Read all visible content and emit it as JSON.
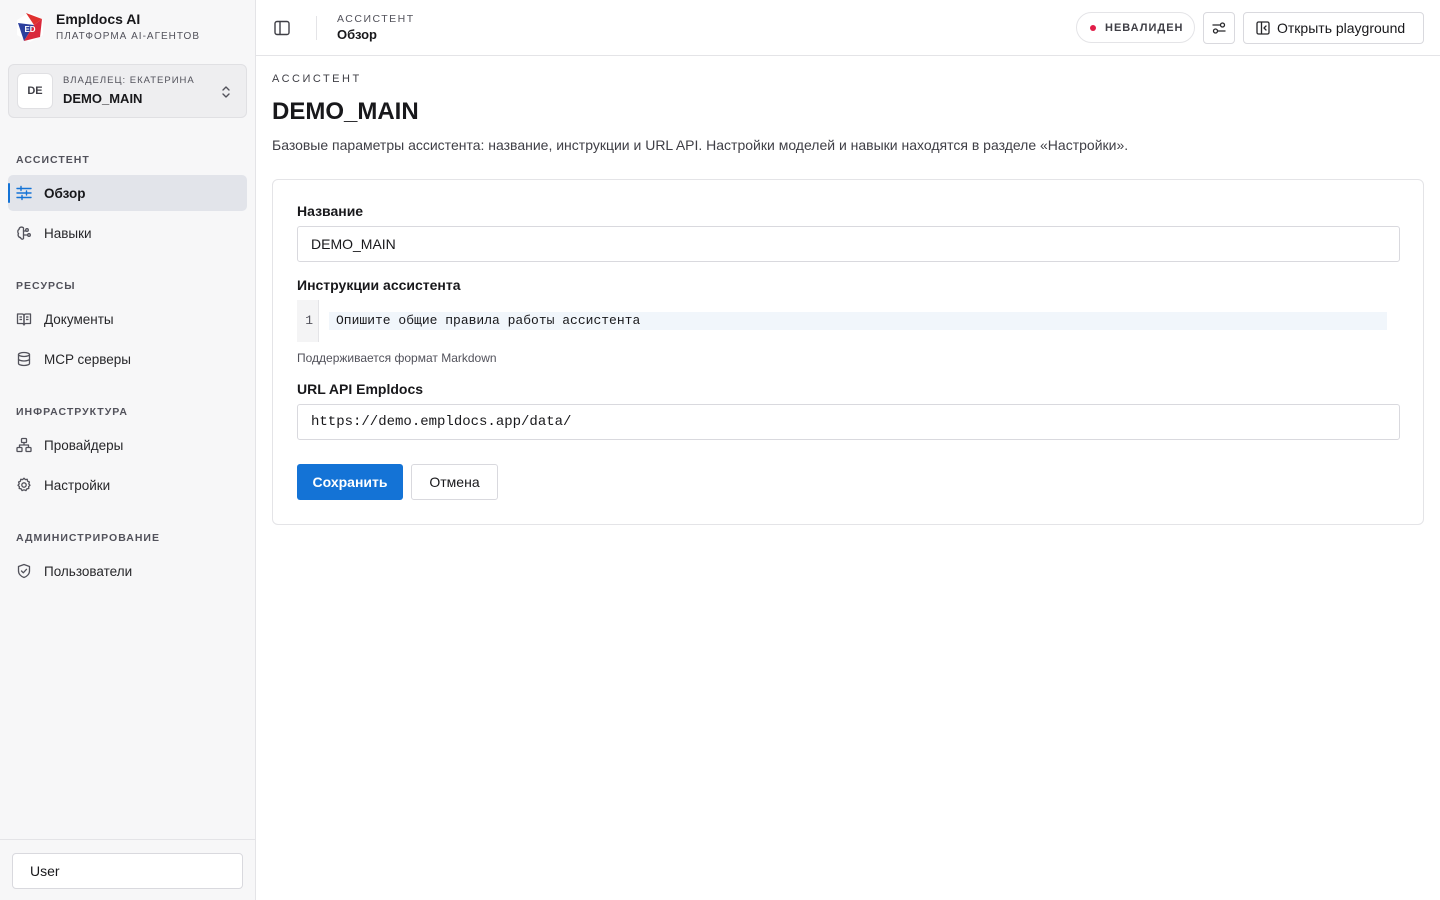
{
  "brand": {
    "name": "Empldocs AI",
    "subtitle": "ПЛАТФОРМА AI-АГЕНТОВ",
    "logo_text": "ED"
  },
  "owner": {
    "initials": "DE",
    "label": "ВЛАДЕЛЕЦ: ЕКАТЕРИНА",
    "name": "DEMO_MAIN"
  },
  "sidebar": {
    "sections": [
      {
        "title": "АССИСТЕНТ",
        "items": [
          {
            "label": "Обзор",
            "icon": "sliders-icon",
            "active": true
          },
          {
            "label": "Навыки",
            "icon": "brain-icon"
          }
        ]
      },
      {
        "title": "РЕСУРСЫ",
        "items": [
          {
            "label": "Документы",
            "icon": "book-icon"
          },
          {
            "label": "MCP серверы",
            "icon": "database-icon"
          }
        ]
      },
      {
        "title": "ИНФРАСТРУКТУРА",
        "items": [
          {
            "label": "Провайдеры",
            "icon": "network-icon"
          },
          {
            "label": "Настройки",
            "icon": "gear-icon"
          }
        ]
      },
      {
        "title": "АДМИНИСТРИРОВАНИЕ",
        "items": [
          {
            "label": "Пользователи",
            "icon": "shield-icon"
          }
        ]
      }
    ],
    "user": "User"
  },
  "header": {
    "crumb_section": "АССИСТЕНТ",
    "crumb_page": "Обзор",
    "status": "НЕВАЛИДЕН",
    "status_color": "#e11d48",
    "playground": "Открыть playground"
  },
  "page": {
    "eyebrow": "АССИСТЕНТ",
    "title": "DEMO_MAIN",
    "description": "Базовые параметры ассистента: название, инструкции и URL API. Настройки моделей и навыки находятся в разделе «Настройки»."
  },
  "form": {
    "name_label": "Название",
    "name_value": "DEMO_MAIN",
    "instructions_label": "Инструкции ассистента",
    "line_number": "1",
    "instructions_placeholder": "Опишите общие правила работы ассистента",
    "markdown_hint": "Поддерживается формат Markdown",
    "url_label": "URL API Empldocs",
    "url_value": "https://demo.empldocs.app/data/",
    "save": "Сохранить",
    "cancel": "Отмена"
  },
  "colors": {
    "accent": "#1473d6",
    "sidebar_bg": "#f7f7f8"
  }
}
